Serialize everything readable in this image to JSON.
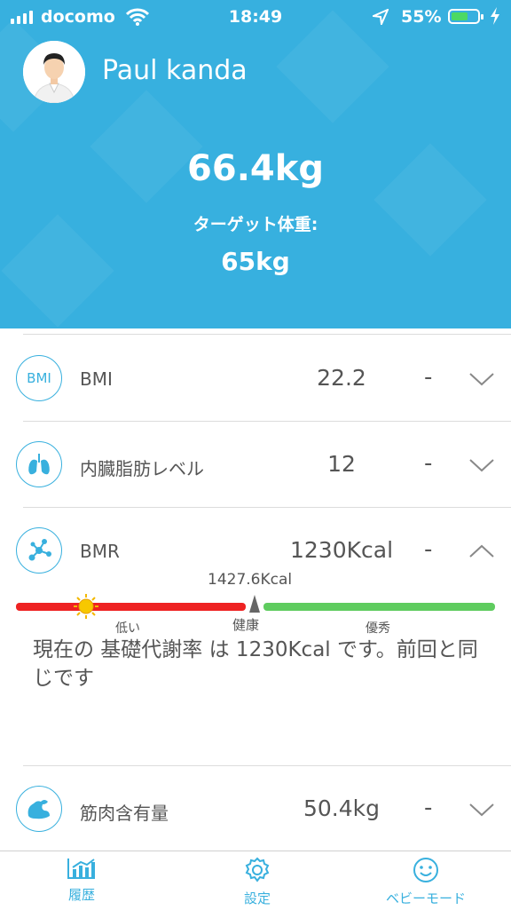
{
  "status_bar": {
    "carrier": "docomo",
    "time": "18:49",
    "battery_percent": "55%"
  },
  "profile": {
    "name": "Paul kanda",
    "current_weight": "66.4kg",
    "target_label": "ターゲット体重:",
    "target_weight": "65kg"
  },
  "metrics": [
    {
      "icon": "bmi-icon",
      "icon_text": "BMI",
      "label": "BMI",
      "value": "22.2",
      "trend": "-",
      "expanded": false
    },
    {
      "icon": "lungs-icon",
      "label": "内臓脂肪レベル",
      "value": "12",
      "trend": "-",
      "expanded": false
    },
    {
      "icon": "molecule-icon",
      "label": "BMR",
      "value": "1230Kcal",
      "trend": "-",
      "expanded": true
    },
    {
      "icon": "muscle-arm-icon",
      "label": "筋肉含有量",
      "value": "50.4kg",
      "trend": "-",
      "expanded": false
    }
  ],
  "bmr_detail": {
    "marker_value": "1427.6Kcal",
    "scale_labels": {
      "low": "低い",
      "healthy": "健康",
      "good": "優秀"
    },
    "description": "現在の 基礎代謝率 は 1230Kcal です。前回と同じです",
    "colors": {
      "low": "#ee2222",
      "good": "#5fcc5f"
    }
  },
  "tabs": [
    {
      "icon": "history-chart-icon",
      "label": "履歴"
    },
    {
      "icon": "settings-gear-icon",
      "label": "設定"
    },
    {
      "icon": "baby-smile-icon",
      "label": "ベビーモード"
    }
  ],
  "colors": {
    "accent": "#37b0df"
  }
}
